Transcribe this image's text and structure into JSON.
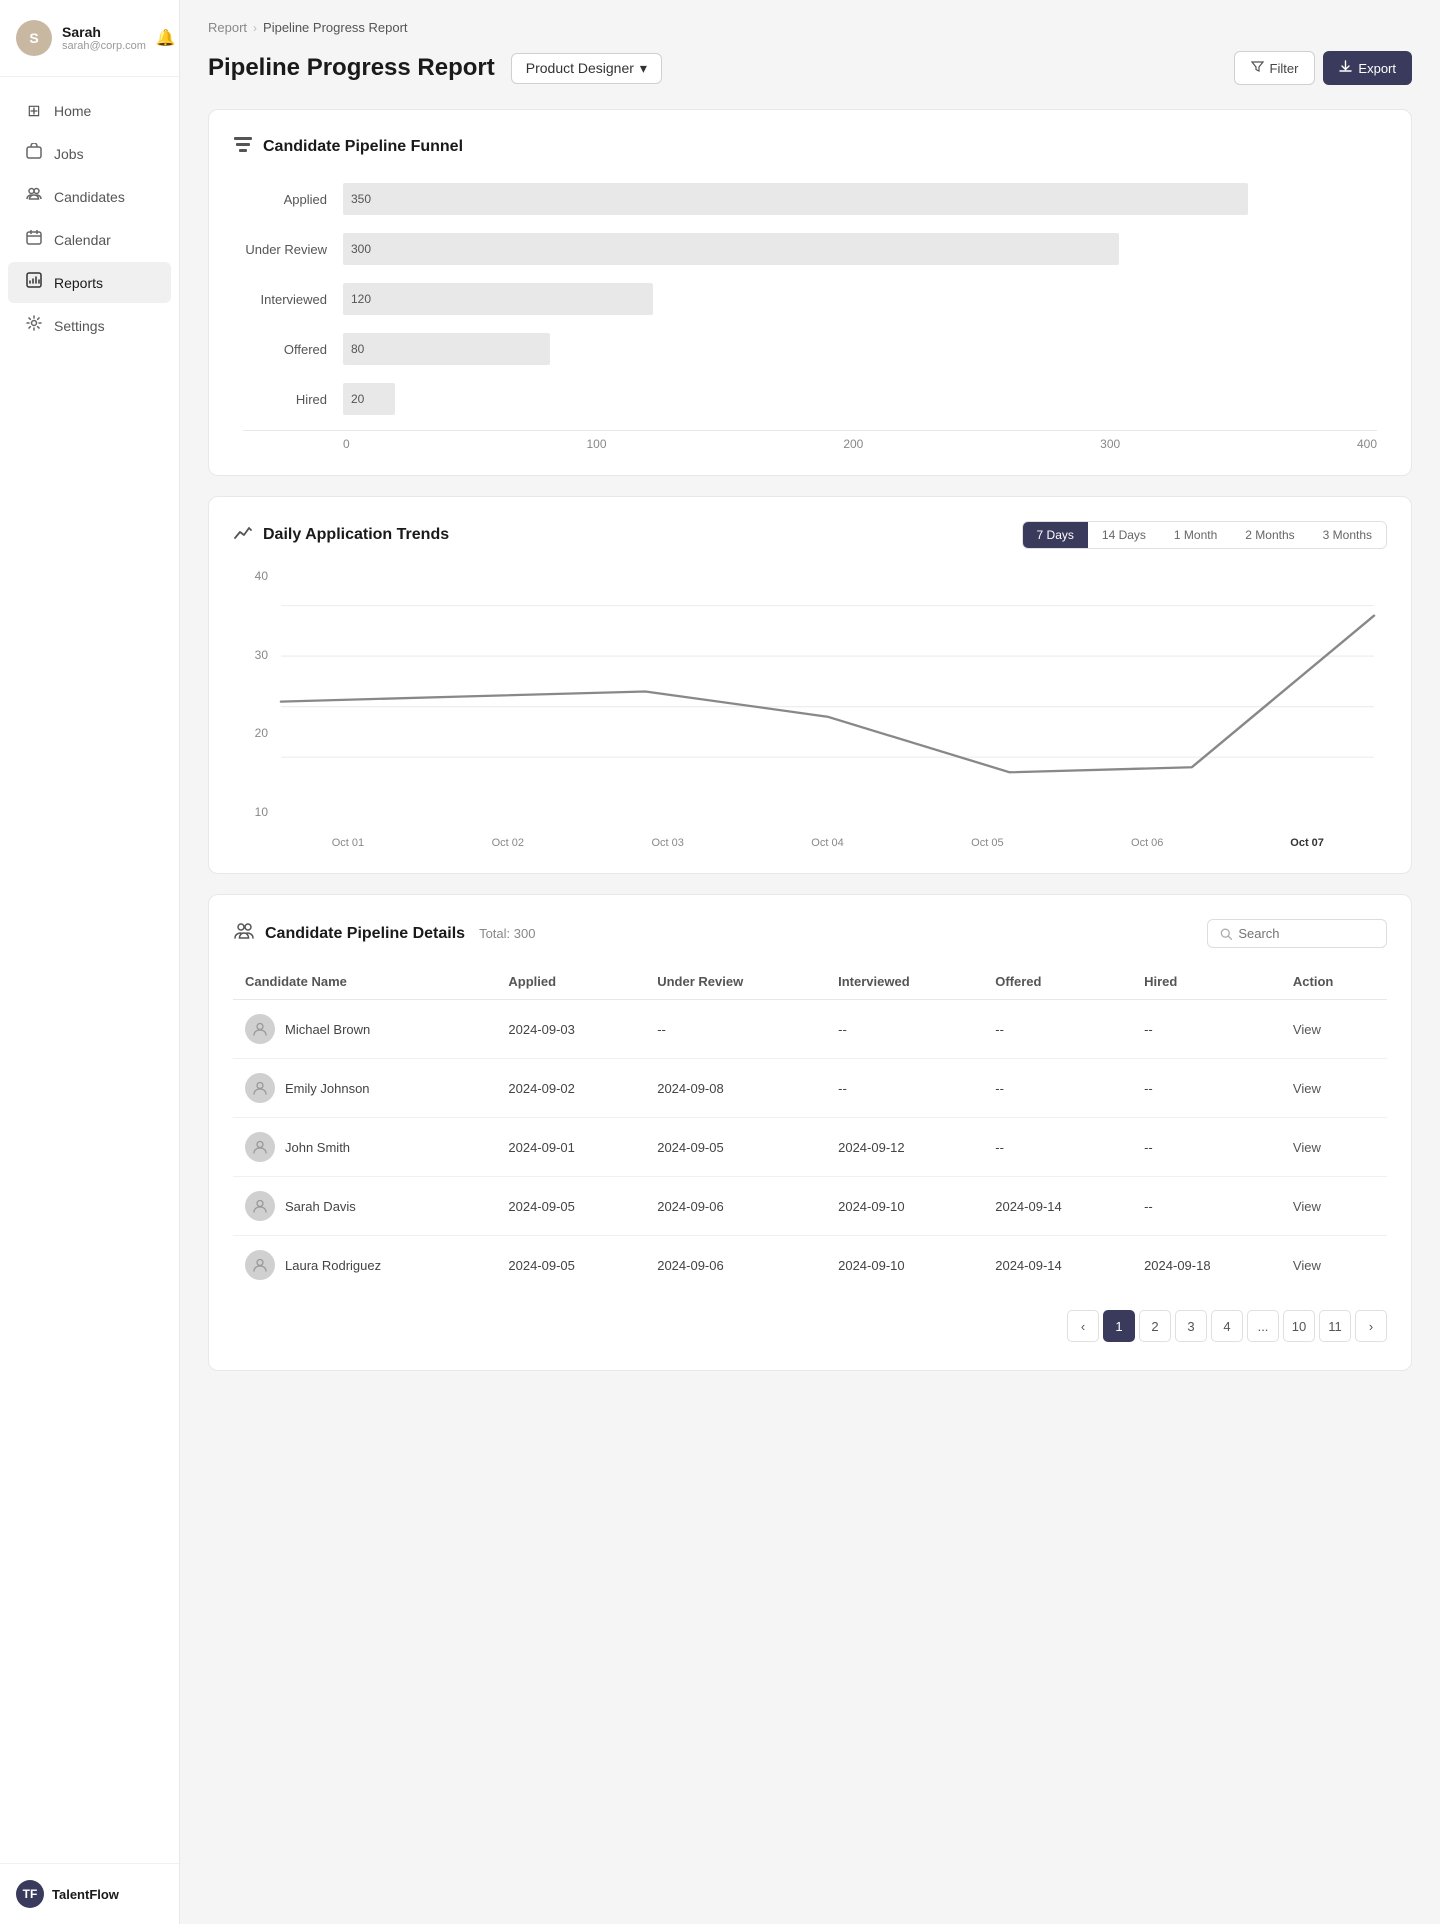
{
  "sidebar": {
    "user": {
      "name": "Sarah",
      "email": "sarah@corp.com",
      "initials": "S"
    },
    "nav": [
      {
        "id": "home",
        "label": "Home",
        "icon": "⊞"
      },
      {
        "id": "jobs",
        "label": "Jobs",
        "icon": "📋"
      },
      {
        "id": "candidates",
        "label": "Candidates",
        "icon": "👥"
      },
      {
        "id": "calendar",
        "label": "Calendar",
        "icon": "📅"
      },
      {
        "id": "reports",
        "label": "Reports",
        "icon": "📊",
        "active": true
      },
      {
        "id": "settings",
        "label": "Settings",
        "icon": "⚙"
      }
    ],
    "brand": {
      "name": "TalentFlow",
      "initials": "TF"
    }
  },
  "breadcrumb": {
    "parent": "Report",
    "current": "Pipeline Progress Report"
  },
  "page": {
    "title": "Pipeline Progress Report",
    "dropdown_label": "Product Designer",
    "filter_label": "Filter",
    "export_label": "Export"
  },
  "funnel": {
    "title": "Candidate Pipeline Funnel",
    "stages": [
      {
        "label": "Applied",
        "value": 350,
        "pct": 87.5
      },
      {
        "label": "Under Review",
        "value": 300,
        "pct": 75
      },
      {
        "label": "Interviewed",
        "value": 120,
        "pct": 30
      },
      {
        "label": "Offered",
        "value": 80,
        "pct": 20
      },
      {
        "label": "Hired",
        "value": 20,
        "pct": 5
      }
    ],
    "axis": [
      "0",
      "100",
      "200",
      "300",
      "400"
    ]
  },
  "trend": {
    "title": "Daily Application Trends",
    "time_filters": [
      "7 Days",
      "14 Days",
      "1 Month",
      "2 Months",
      "3 Months"
    ],
    "active_filter": "7 Days",
    "y_labels": [
      "40",
      "30",
      "20",
      "10"
    ],
    "x_labels": [
      "Oct 01",
      "Oct 02",
      "Oct 03",
      "Oct 04",
      "Oct 05",
      "Oct 06",
      "Oct 07"
    ],
    "points": [
      {
        "day": "Oct 01",
        "value": 21
      },
      {
        "day": "Oct 02",
        "value": 22
      },
      {
        "day": "Oct 03",
        "value": 23
      },
      {
        "day": "Oct 04",
        "value": 18
      },
      {
        "day": "Oct 05",
        "value": 7
      },
      {
        "day": "Oct 06",
        "value": 8
      },
      {
        "day": "Oct 07",
        "value": 38
      }
    ]
  },
  "pipeline_details": {
    "title": "Candidate Pipeline Details",
    "total_label": "Total: 300",
    "search_placeholder": "Search",
    "columns": [
      "Candidate Name",
      "Applied",
      "Under Review",
      "Interviewed",
      "Offered",
      "Hired",
      "Action"
    ],
    "rows": [
      {
        "name": "Michael Brown",
        "applied": "2024-09-03",
        "under_review": "--",
        "interviewed": "--",
        "offered": "--",
        "hired": "--"
      },
      {
        "name": "Emily Johnson",
        "applied": "2024-09-02",
        "under_review": "2024-09-08",
        "interviewed": "--",
        "offered": "--",
        "hired": "--"
      },
      {
        "name": "John Smith",
        "applied": "2024-09-01",
        "under_review": "2024-09-05",
        "interviewed": "2024-09-12",
        "offered": "--",
        "hired": "--"
      },
      {
        "name": "Sarah Davis",
        "applied": "2024-09-05",
        "under_review": "2024-09-06",
        "interviewed": "2024-09-10",
        "offered": "2024-09-14",
        "hired": "--"
      },
      {
        "name": "Laura Rodriguez",
        "applied": "2024-09-05",
        "under_review": "2024-09-06",
        "interviewed": "2024-09-10",
        "offered": "2024-09-14",
        "hired": "2024-09-18"
      }
    ],
    "action_label": "View",
    "pagination": {
      "pages": [
        "1",
        "2",
        "3",
        "4",
        "...",
        "10",
        "11"
      ],
      "active_page": "1"
    }
  }
}
